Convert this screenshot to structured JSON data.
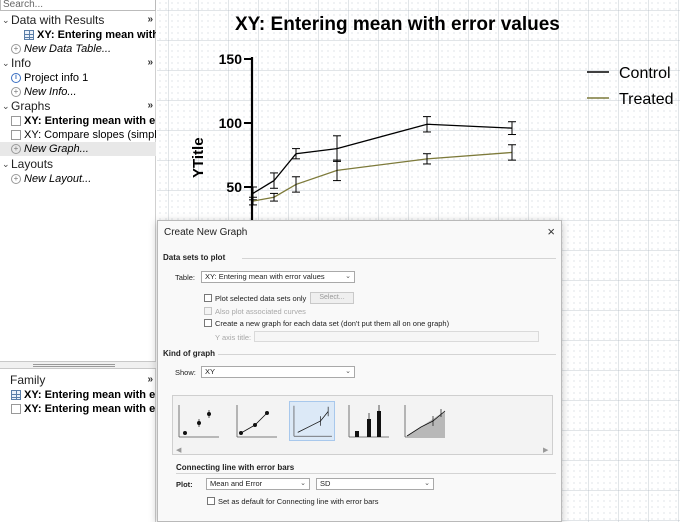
{
  "navigator": {
    "search_placeholder": "Search...",
    "sections": [
      {
        "label": "Data with Results",
        "collapse": "»"
      },
      {
        "label": "Info",
        "collapse": "»"
      },
      {
        "label": "Graphs",
        "collapse": "»"
      },
      {
        "label": "Layouts",
        "collapse": ""
      }
    ],
    "data_items": [
      "XY: Entering mean with e",
      "New Data Table..."
    ],
    "info_items": [
      "Project info 1",
      "New Info..."
    ],
    "graph_items": [
      "XY: Entering mean with erro",
      "XY: Compare slopes (simple l",
      "New Graph..."
    ],
    "layout_items": [
      "New Layout..."
    ],
    "family": {
      "label": "Family",
      "collapse": "»",
      "items": [
        "XY: Entering mean with erro",
        "XY: Entering mean with erro"
      ]
    }
  },
  "graph": {
    "title": "XY: Entering mean with error values",
    "ytitle": "YTitle",
    "legend": [
      "Control",
      "Treated"
    ]
  },
  "chart_data": {
    "type": "line",
    "title": "XY: Entering mean with error values",
    "ylabel": "YTitle",
    "xlabel": "",
    "y_ticks": [
      "150",
      "100",
      "50"
    ],
    "ylim": [
      30,
      150
    ],
    "x": [
      1,
      2,
      3,
      4,
      6,
      8
    ],
    "series": [
      {
        "name": "Control",
        "color": "#000000",
        "values": [
          45,
          55,
          76,
          80,
          99,
          96
        ],
        "errors": [
          5,
          6,
          4,
          10,
          6,
          5
        ]
      },
      {
        "name": "Treated",
        "color": "#7d7a3a",
        "values": [
          39,
          42,
          52,
          63,
          72,
          77
        ],
        "errors": [
          3,
          3,
          6,
          8,
          4,
          6
        ]
      }
    ],
    "legend_position": "top-right",
    "grid": false
  },
  "dialog": {
    "title": "Create New Graph",
    "close": "×",
    "section_datasets": "Data sets to plot",
    "table_label": "Table:",
    "table_value": "XY: Entering mean with error values",
    "plot_selected": "Plot selected data sets only",
    "select_button": "Select...",
    "also_plot": "Also plot associated curves",
    "new_graph_each": "Create a new graph for each data set (don't put them all on one graph)",
    "yaxis_title": "Y axis title:",
    "section_kind": "Kind of graph",
    "show_label": "Show:",
    "show_value": "XY",
    "connecting_title": "Connecting line with error bars",
    "plot_label": "Plot:",
    "plot_value": "Mean and Error",
    "error_value": "SD",
    "set_default": "Set as default for Connecting line with error bars",
    "dropdown_glyph": "⌄"
  }
}
